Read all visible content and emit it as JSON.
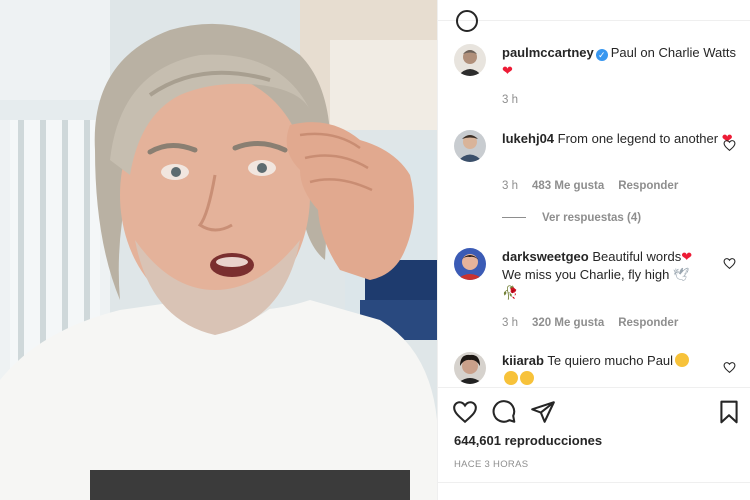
{
  "post": {
    "views_text": "644,601 reproducciones",
    "time_ago_text": "HACE 3 HORAS"
  },
  "caption": {
    "username": "paulmccartney",
    "text": "Paul on Charlie Watts",
    "heart": "❤",
    "time": "3 h"
  },
  "comments": [
    {
      "username": "lukehj04",
      "text": "From one legend to another",
      "heart": "❤",
      "time": "3 h",
      "likes": "483 Me gusta",
      "reply": "Responder",
      "view_replies": "Ver respuestas (4)"
    },
    {
      "username": "darksweetgeo",
      "text": "Beautiful words",
      "heart": "❤",
      "text2": "We miss you Charlie, fly high",
      "dove": "🕊",
      "rose": "🥀",
      "time": "3 h",
      "likes": "320 Me gusta",
      "reply": "Responder"
    },
    {
      "username": "kiiarab",
      "text": "Te quiero mucho Paul",
      "time": "",
      "likes": "",
      "reply": ""
    }
  ],
  "colors": {
    "heart": "#ed1c36",
    "verified": "#3897f0",
    "muted": "#8e8e8e",
    "text": "#262626"
  },
  "icons": {
    "like": "heart-outline-icon",
    "comment": "comment-bubble-icon",
    "share": "paper-plane-icon",
    "save": "bookmark-icon",
    "verified": "verified-badge-icon"
  }
}
